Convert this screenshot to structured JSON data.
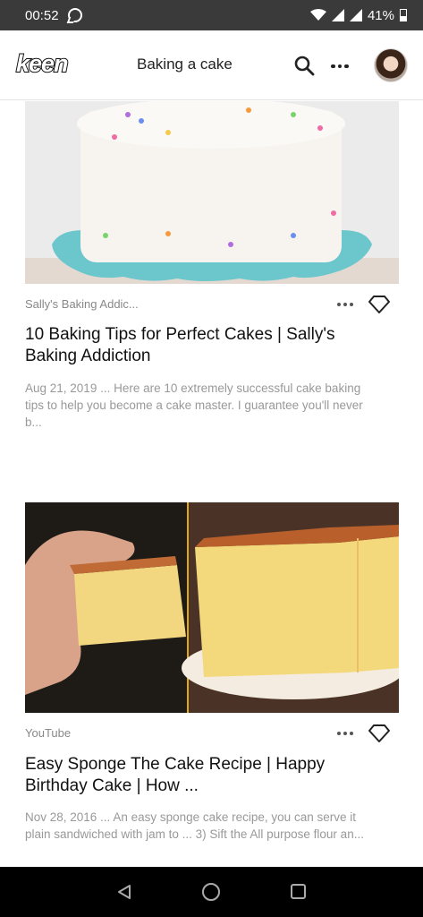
{
  "status_bar": {
    "time": "00:52",
    "battery": "41%"
  },
  "header": {
    "logo": "keen",
    "title": "Baking a cake",
    "search_icon": "search-icon",
    "more_icon": "more-horizontal-icon",
    "avatar_icon": "user-avatar"
  },
  "cards": [
    {
      "source": "Sally's Baking Addic...",
      "title": "10 Baking Tips for Perfect Cakes | Sally's Baking Addiction",
      "snippet": "Aug 21, 2019 ... Here are 10 extremely successful cake baking tips to help you become a cake master. I guarantee you'll never b...",
      "image": "frosted-sprinkle-cake"
    },
    {
      "source": "YouTube",
      "title": "Easy Sponge The Cake Recipe | Happy Birthday Cake | How ...",
      "snippet": "Nov 28, 2016 ... An easy sponge cake recipe, you can serve it plain sandwiched with jam to ... 3) Sift the All purpose flour an...",
      "image": "sponge-cake-slices"
    }
  ],
  "colors": {
    "status_bar": "#3a3a3a",
    "nav_bar": "#000000",
    "source_text": "#888888",
    "snippet_text": "#999999"
  }
}
